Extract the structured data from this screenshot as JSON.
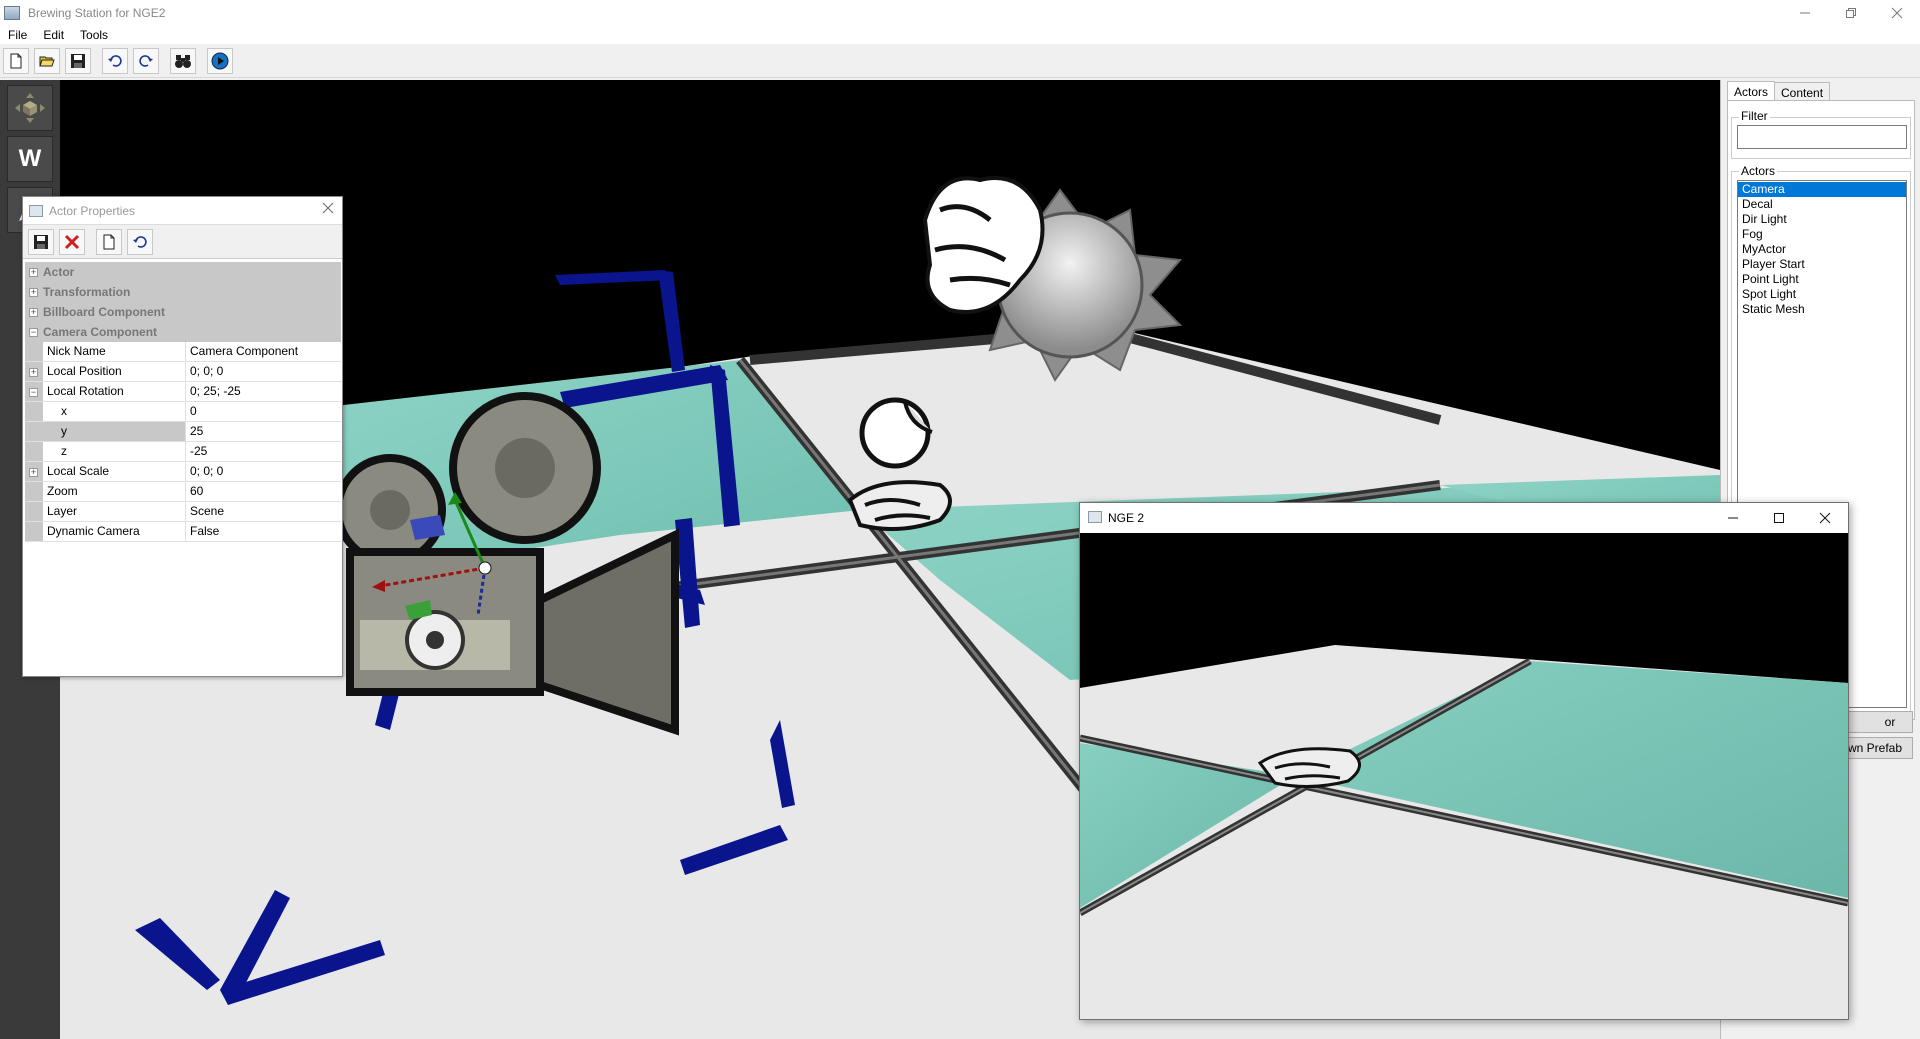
{
  "app": {
    "title": "Brewing Station for NGE2"
  },
  "menu": {
    "file": "File",
    "edit": "Edit",
    "tools": "Tools"
  },
  "toolbar": {
    "icons": [
      "new-document-icon",
      "open-folder-icon",
      "save-icon",
      "undo-icon",
      "redo-icon",
      "binoculars-icon",
      "play-icon"
    ]
  },
  "left_tools": {
    "move_label": "",
    "world_label": "W"
  },
  "right_panel": {
    "tabs": [
      "Actors",
      "Content"
    ],
    "filter_label": "Filter",
    "filter_value": "",
    "actors_label": "Actors",
    "actors": [
      "Camera",
      "Decal",
      "Dir Light",
      "Fog",
      "MyActor",
      "Player Start",
      "Point Light",
      "Spot Light",
      "Static Mesh"
    ],
    "selected_actor": "Camera",
    "button_1_visible": "or",
    "button_2_visible": "wn Prefab"
  },
  "properties": {
    "title": "Actor Properties",
    "categories": [
      "Actor",
      "Transformation",
      "Billboard Component",
      "Camera Component"
    ],
    "rows": [
      {
        "name": "Nick Name",
        "value": "Camera Component"
      },
      {
        "name": "Local Position",
        "value": "0; 0; 0"
      },
      {
        "name": "Local Rotation",
        "value": "0; 25; -25"
      },
      {
        "name": "x",
        "value": "0"
      },
      {
        "name": "y",
        "value": "25"
      },
      {
        "name": "z",
        "value": "-25"
      },
      {
        "name": "Local Scale",
        "value": "0; 0; 0"
      },
      {
        "name": "Zoom",
        "value": "60"
      },
      {
        "name": "Layer",
        "value": "Scene"
      },
      {
        "name": "Dynamic Camera",
        "value": "False"
      }
    ]
  },
  "game_window": {
    "title": "NGE 2"
  },
  "colors": {
    "teal": "#7fc9bb",
    "floor": "#e6e6e6",
    "navy": "#0a148c",
    "selection": "#0078d7"
  }
}
